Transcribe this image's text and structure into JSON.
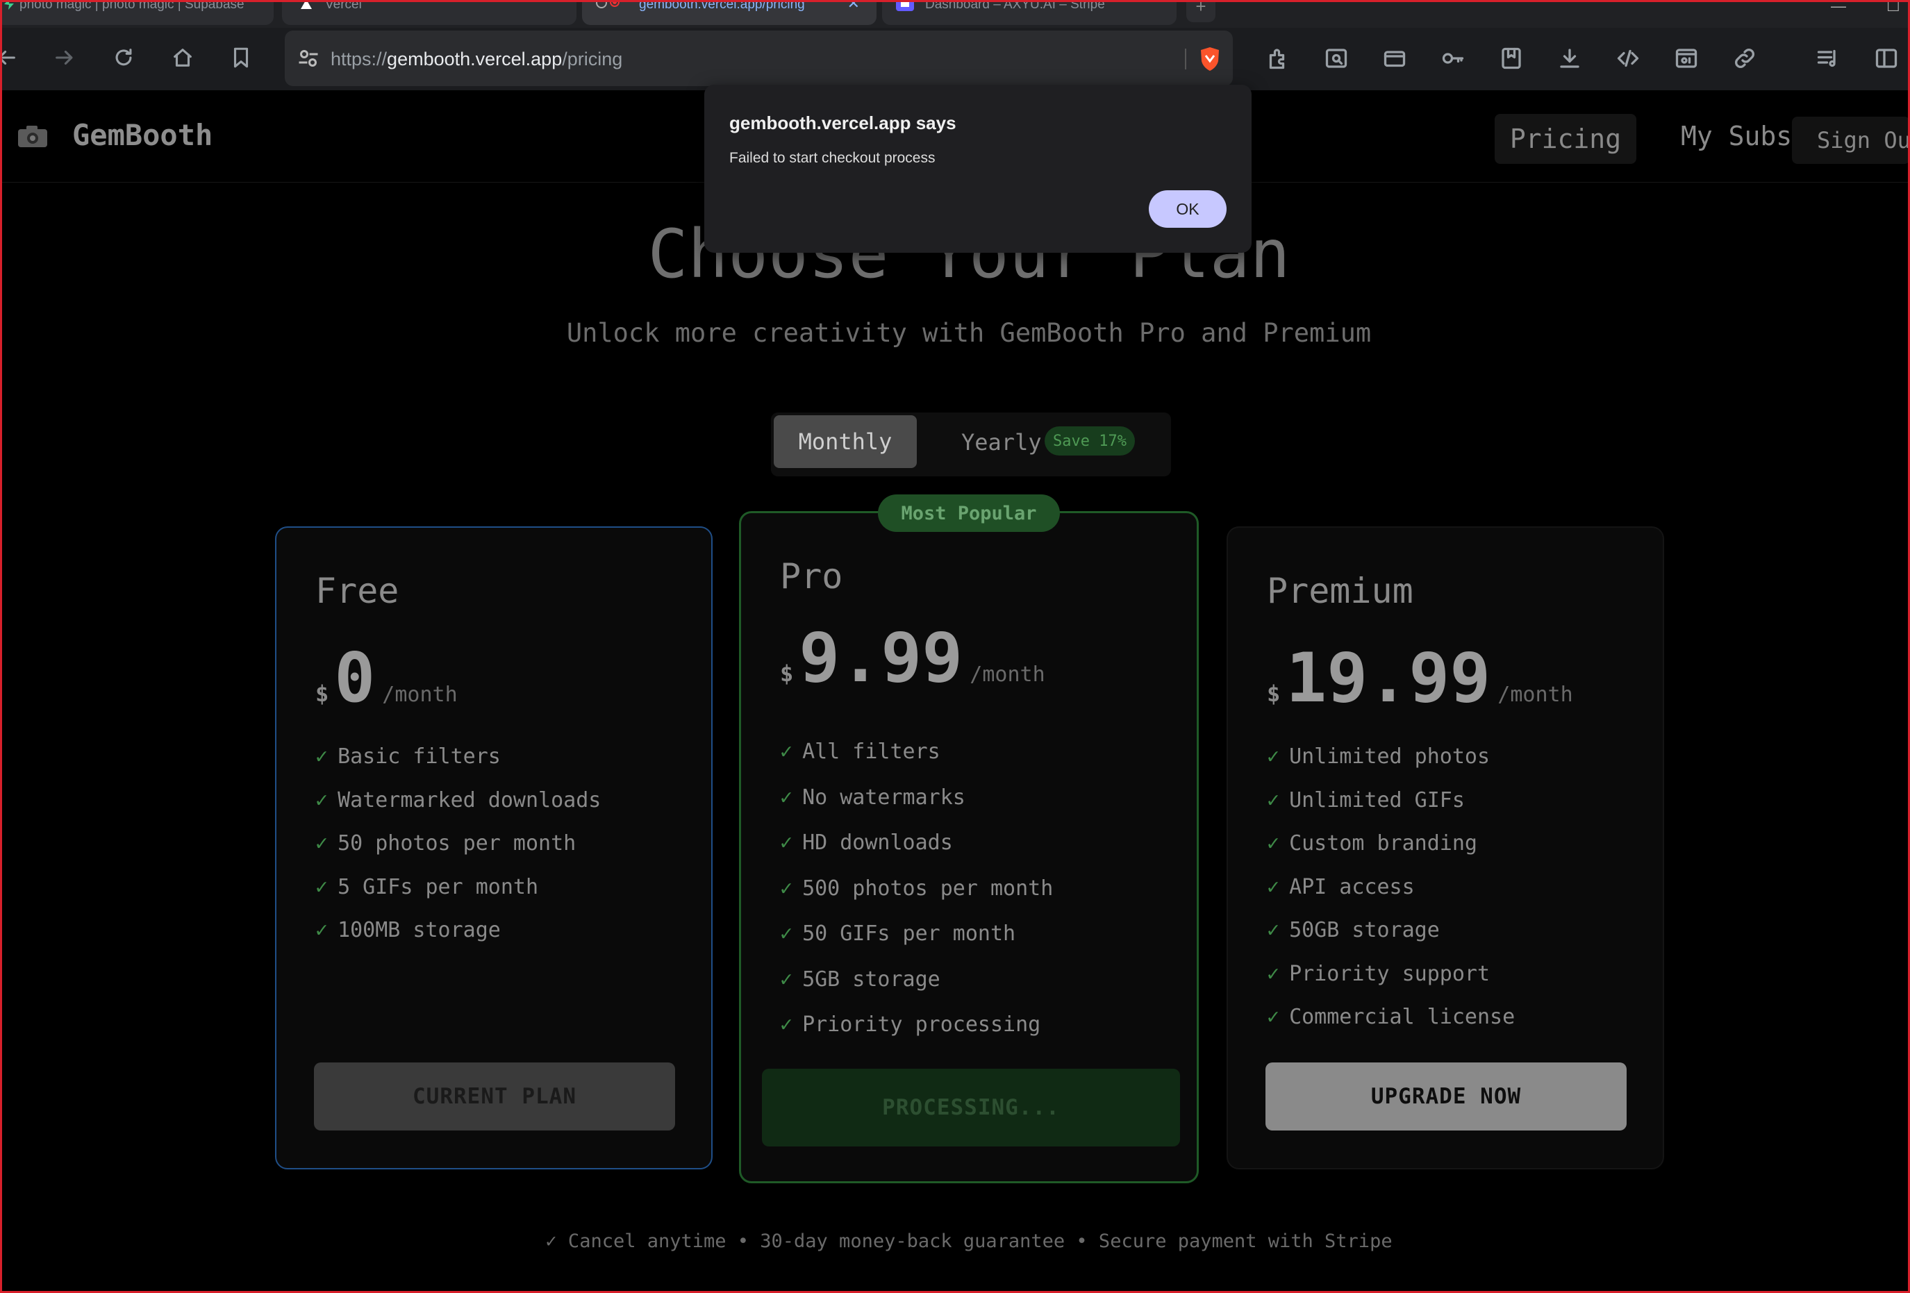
{
  "browser": {
    "tabs": [
      {
        "label": "photo magic | photo magic | Supabase",
        "active": false
      },
      {
        "label": "Vercel",
        "active": false
      },
      {
        "label": "gembooth.vercel.app/pricing",
        "active": true
      },
      {
        "label": "Dashboard – AXYU.AI – Stripe",
        "active": false
      }
    ],
    "new_tab_label": "+",
    "url_prefix": "https://",
    "url_host": "gembooth.vercel.app",
    "url_path": "/pricing"
  },
  "site": {
    "brand": "GemBooth",
    "nav": {
      "pricing": "Pricing",
      "subscriptions": "My Subscriptions",
      "sign_out": "Sign Out"
    }
  },
  "hero": {
    "title": "Choose Your Plan",
    "subtitle": "Unlock more creativity with GemBooth Pro and Premium"
  },
  "billing_toggle": {
    "monthly": "Monthly",
    "yearly": "Yearly",
    "save_badge": "Save 17%",
    "selected": "Monthly"
  },
  "plans": {
    "free": {
      "name": "Free",
      "currency": "$",
      "price": "0",
      "period": "/month",
      "features": [
        "Basic filters",
        "Watermarked downloads",
        "50 photos per month",
        "5 GIFs per month",
        "100MB storage"
      ],
      "button": "CURRENT PLAN"
    },
    "pro": {
      "badge": "Most Popular",
      "name": "Pro",
      "currency": "$",
      "price": "9.99",
      "period": "/month",
      "features": [
        "All filters",
        "No watermarks",
        "HD downloads",
        "500 photos per month",
        "50 GIFs per month",
        "5GB storage",
        "Priority processing"
      ],
      "button": "PROCESSING..."
    },
    "premium": {
      "name": "Premium",
      "currency": "$",
      "price": "19.99",
      "period": "/month",
      "features": [
        "Unlimited photos",
        "Unlimited GIFs",
        "Custom branding",
        "API access",
        "50GB storage",
        "Priority support",
        "Commercial license"
      ],
      "button": "UPGRADE NOW"
    }
  },
  "check_glyph": "✓",
  "footnote": "✓ Cancel anytime • 30-day money-back guarantee • Secure payment with Stripe",
  "dialog": {
    "title": "gembooth.vercel.app says",
    "message": "Failed to start checkout process",
    "ok": "OK"
  },
  "colors": {
    "accent_green": "#3e8a47",
    "free_border": "#1f4e87",
    "pro_border": "#1f5a27",
    "dialog_button": "#c7c8ff",
    "window_frame": "#d8202b"
  }
}
